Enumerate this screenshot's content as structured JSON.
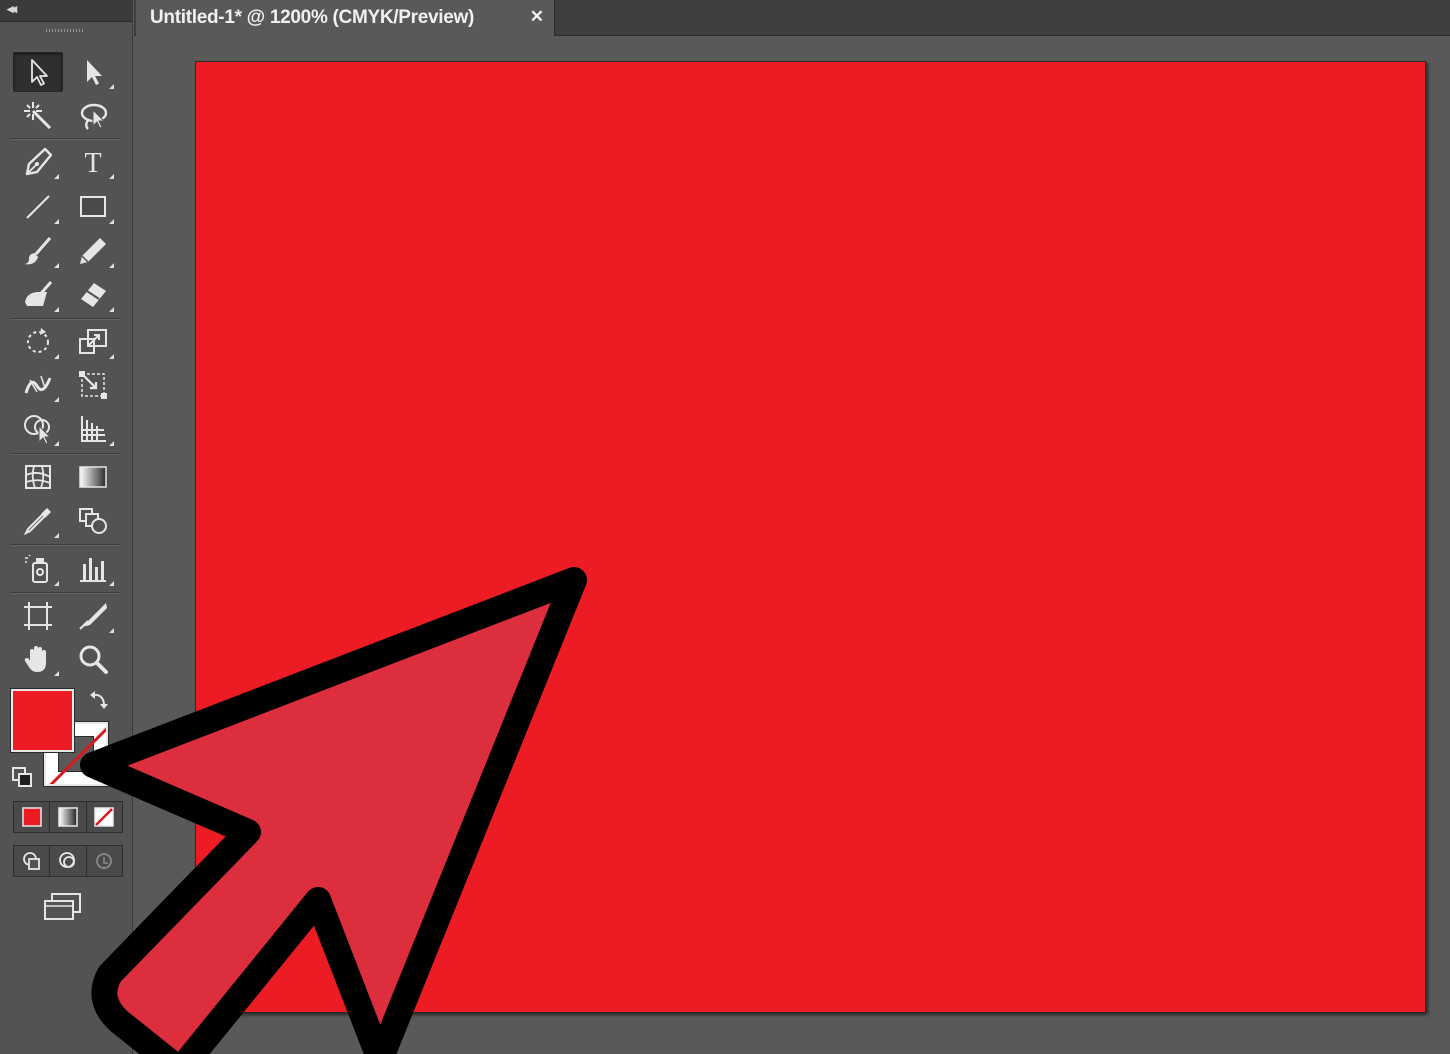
{
  "document": {
    "tab_title": "Untitled-1* @ 1200% (CMYK/Preview)",
    "close_glyph": "✕"
  },
  "tools_panel": {
    "collapse_glyph": "◂◂",
    "tools": [
      {
        "name": "selection-tool",
        "icon": "selection-arrow-icon"
      },
      {
        "name": "direct-selection-tool",
        "icon": "direct-selection-arrow-icon"
      },
      {
        "name": "magic-wand-tool",
        "icon": "magic-wand-icon"
      },
      {
        "name": "lasso-tool",
        "icon": "lasso-icon"
      },
      {
        "name": "pen-tool",
        "icon": "pen-icon"
      },
      {
        "name": "type-tool",
        "icon": "type-icon",
        "glyph": "T"
      },
      {
        "name": "line-segment-tool",
        "icon": "line-icon"
      },
      {
        "name": "rectangle-tool",
        "icon": "rectangle-icon"
      },
      {
        "name": "paintbrush-tool",
        "icon": "paintbrush-icon"
      },
      {
        "name": "pencil-tool",
        "icon": "pencil-icon"
      },
      {
        "name": "blob-brush-tool",
        "icon": "blob-brush-icon"
      },
      {
        "name": "eraser-tool",
        "icon": "eraser-icon"
      },
      {
        "name": "rotate-tool",
        "icon": "rotate-icon"
      },
      {
        "name": "scale-tool",
        "icon": "scale-icon"
      },
      {
        "name": "width-tool",
        "icon": "width-icon"
      },
      {
        "name": "free-transform-tool",
        "icon": "free-transform-icon"
      },
      {
        "name": "shape-builder-tool",
        "icon": "shape-builder-icon"
      },
      {
        "name": "perspective-grid-tool",
        "icon": "perspective-grid-icon"
      },
      {
        "name": "mesh-tool",
        "icon": "mesh-icon"
      },
      {
        "name": "gradient-tool",
        "icon": "gradient-icon"
      },
      {
        "name": "eyedropper-tool",
        "icon": "eyedropper-icon"
      },
      {
        "name": "blend-tool",
        "icon": "blend-icon"
      },
      {
        "name": "symbol-sprayer-tool",
        "icon": "symbol-sprayer-icon"
      },
      {
        "name": "column-graph-tool",
        "icon": "column-graph-icon"
      },
      {
        "name": "artboard-tool",
        "icon": "artboard-icon"
      },
      {
        "name": "slice-tool",
        "icon": "slice-icon"
      },
      {
        "name": "hand-tool",
        "icon": "hand-icon"
      },
      {
        "name": "zoom-tool",
        "icon": "zoom-icon"
      }
    ],
    "fill_color": "#ed1c24",
    "stroke_color": "none",
    "color_modes": [
      "color-mode-icon",
      "gradient-mode-icon",
      "none-mode-icon"
    ],
    "draw_modes": [
      "draw-normal-icon",
      "draw-behind-icon",
      "draw-inside-icon"
    ],
    "screen_mode_icon": "screen-mode-icon"
  },
  "canvas": {
    "background": "#595959",
    "artboard_fill": "#ed1c24",
    "zoom": "1200%",
    "color_mode": "CMYK/Preview"
  },
  "overlay": {
    "pointer_arrow_fill": "#dd2e3d",
    "pointer_arrow_stroke": "#000000"
  }
}
